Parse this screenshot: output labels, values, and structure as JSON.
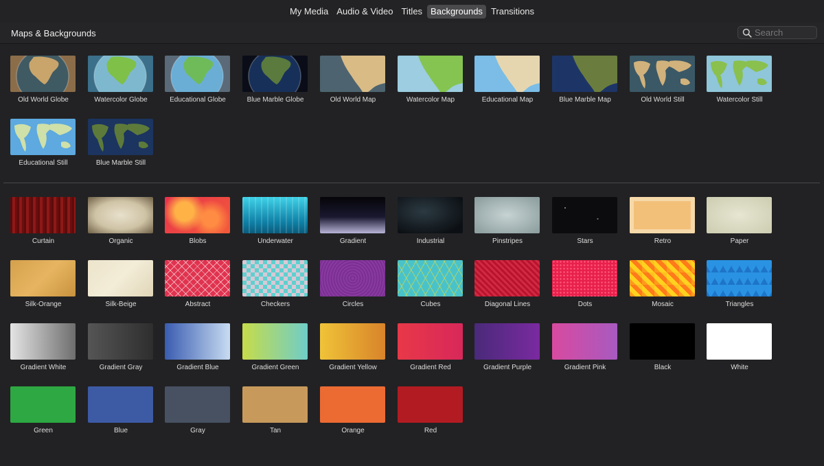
{
  "tabs": [
    {
      "label": "My Media",
      "active": false
    },
    {
      "label": "Audio & Video",
      "active": false
    },
    {
      "label": "Titles",
      "active": false
    },
    {
      "label": "Backgrounds",
      "active": true
    },
    {
      "label": "Transitions",
      "active": false
    }
  ],
  "header": {
    "title": "Maps & Backgrounds"
  },
  "search": {
    "placeholder": "Search",
    "value": "",
    "icon": "search-icon"
  },
  "maps": [
    {
      "label": "Old World Globe",
      "style": "globe-old"
    },
    {
      "label": "Watercolor Globe",
      "style": "globe-water"
    },
    {
      "label": "Educational Globe",
      "style": "globe-edu"
    },
    {
      "label": "Blue Marble Globe",
      "style": "globe-marble"
    },
    {
      "label": "Old World Map",
      "style": "map-old"
    },
    {
      "label": "Watercolor Map",
      "style": "map-water"
    },
    {
      "label": "Educational Map",
      "style": "map-edu"
    },
    {
      "label": "Blue Marble Map",
      "style": "map-marble"
    },
    {
      "label": "Old World Still",
      "style": "still-old"
    },
    {
      "label": "Watercolor Still",
      "style": "still-water"
    },
    {
      "label": "Educational Still",
      "style": "still-edu"
    },
    {
      "label": "Blue Marble Still",
      "style": "still-marble"
    }
  ],
  "backgrounds": [
    {
      "label": "Curtain",
      "style": "curtain"
    },
    {
      "label": "Organic",
      "style": "organic"
    },
    {
      "label": "Blobs",
      "style": "blobs"
    },
    {
      "label": "Underwater",
      "style": "underwater"
    },
    {
      "label": "Gradient",
      "style": "gradient"
    },
    {
      "label": "Industrial",
      "style": "industrial"
    },
    {
      "label": "Pinstripes",
      "style": "pinstripes"
    },
    {
      "label": "Stars",
      "style": "stars"
    },
    {
      "label": "Retro",
      "style": "retro"
    },
    {
      "label": "Paper",
      "style": "paper"
    },
    {
      "label": "Silk-Orange",
      "style": "silk-orange"
    },
    {
      "label": "Silk-Beige",
      "style": "silk-beige"
    },
    {
      "label": "Abstract",
      "style": "abstract"
    },
    {
      "label": "Checkers",
      "style": "checkers"
    },
    {
      "label": "Circles",
      "style": "circles"
    },
    {
      "label": "Cubes",
      "style": "cubes"
    },
    {
      "label": "Diagonal Lines",
      "style": "diagonal"
    },
    {
      "label": "Dots",
      "style": "dots"
    },
    {
      "label": "Mosaic",
      "style": "mosaic"
    },
    {
      "label": "Triangles",
      "style": "triangles"
    },
    {
      "label": "Gradient White",
      "style": "grad-white"
    },
    {
      "label": "Gradient Gray",
      "style": "grad-gray"
    },
    {
      "label": "Gradient Blue",
      "style": "grad-blue"
    },
    {
      "label": "Gradient Green",
      "style": "grad-green"
    },
    {
      "label": "Gradient Yellow",
      "style": "grad-yellow"
    },
    {
      "label": "Gradient Red",
      "style": "grad-red"
    },
    {
      "label": "Gradient Purple",
      "style": "grad-purple"
    },
    {
      "label": "Gradient Pink",
      "style": "grad-pink"
    },
    {
      "label": "Black",
      "style": "black"
    },
    {
      "label": "White",
      "style": "white"
    },
    {
      "label": "Green",
      "style": "green"
    },
    {
      "label": "Blue",
      "style": "blue"
    },
    {
      "label": "Gray",
      "style": "gray"
    },
    {
      "label": "Tan",
      "style": "tan"
    },
    {
      "label": "Orange",
      "style": "orange"
    },
    {
      "label": "Red",
      "style": "red"
    }
  ]
}
